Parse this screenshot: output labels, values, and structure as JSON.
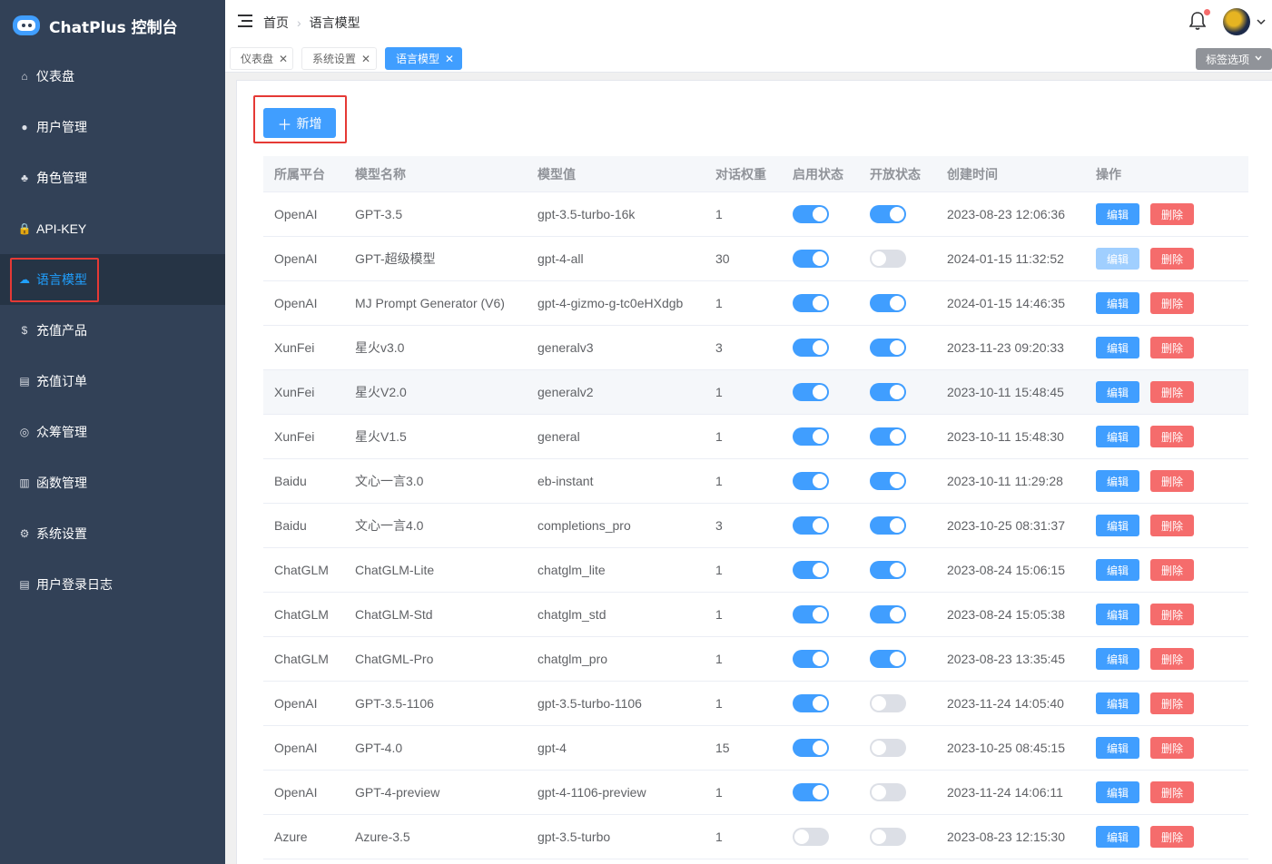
{
  "brand": {
    "title": "ChatPlus 控制台"
  },
  "sidebar": {
    "items": [
      {
        "label": "仪表盘",
        "icon": "home-icon"
      },
      {
        "label": "用户管理",
        "icon": "user-icon"
      },
      {
        "label": "角色管理",
        "icon": "role-icon"
      },
      {
        "label": "API-KEY",
        "icon": "lock-icon"
      },
      {
        "label": "语言模型",
        "icon": "model-icon",
        "active": true
      },
      {
        "label": "充值产品",
        "icon": "dollar-icon"
      },
      {
        "label": "充值订单",
        "icon": "order-icon"
      },
      {
        "label": "众筹管理",
        "icon": "crowdfund-icon"
      },
      {
        "label": "函数管理",
        "icon": "function-icon"
      },
      {
        "label": "系统设置",
        "icon": "gear-icon"
      },
      {
        "label": "用户登录日志",
        "icon": "log-icon"
      }
    ]
  },
  "header": {
    "breadcrumb": [
      "首页",
      "语言模型"
    ]
  },
  "tags": {
    "items": [
      "仪表盘",
      "系统设置",
      "语言模型"
    ],
    "active_index": 2,
    "options_label": "标签选项"
  },
  "toolbar": {
    "add_label": "新增"
  },
  "table": {
    "columns": [
      "所属平台",
      "模型名称",
      "模型值",
      "对话权重",
      "启用状态",
      "开放状态",
      "创建时间",
      "操作"
    ],
    "edit_label": "编辑",
    "delete_label": "删除",
    "rows": [
      {
        "platform": "OpenAI",
        "name": "GPT-3.5",
        "value": "gpt-3.5-turbo-16k",
        "weight": "1",
        "enabled": true,
        "open": true,
        "created": "2023-08-23 12:06:36"
      },
      {
        "platform": "OpenAI",
        "name": "GPT-超级模型",
        "value": "gpt-4-all",
        "weight": "30",
        "enabled": true,
        "open": false,
        "created": "2024-01-15 11:32:52",
        "edit_disabled": true
      },
      {
        "platform": "OpenAI",
        "name": "MJ Prompt Generator (V6)",
        "value": "gpt-4-gizmo-g-tc0eHXdgb",
        "weight": "1",
        "enabled": true,
        "open": true,
        "created": "2024-01-15 14:46:35"
      },
      {
        "platform": "XunFei",
        "name": "星火v3.0",
        "value": "generalv3",
        "weight": "3",
        "enabled": true,
        "open": true,
        "created": "2023-11-23 09:20:33"
      },
      {
        "platform": "XunFei",
        "name": "星火V2.0",
        "value": "generalv2",
        "weight": "1",
        "enabled": true,
        "open": true,
        "created": "2023-10-11 15:48:45",
        "hover": true
      },
      {
        "platform": "XunFei",
        "name": "星火V1.5",
        "value": "general",
        "weight": "1",
        "enabled": true,
        "open": true,
        "created": "2023-10-11 15:48:30"
      },
      {
        "platform": "Baidu",
        "name": "文心一言3.0",
        "value": "eb-instant",
        "weight": "1",
        "enabled": true,
        "open": true,
        "created": "2023-10-11 11:29:28"
      },
      {
        "platform": "Baidu",
        "name": "文心一言4.0",
        "value": "completions_pro",
        "weight": "3",
        "enabled": true,
        "open": true,
        "created": "2023-10-25 08:31:37"
      },
      {
        "platform": "ChatGLM",
        "name": "ChatGLM-Lite",
        "value": "chatglm_lite",
        "weight": "1",
        "enabled": true,
        "open": true,
        "created": "2023-08-24 15:06:15"
      },
      {
        "platform": "ChatGLM",
        "name": "ChatGLM-Std",
        "value": "chatglm_std",
        "weight": "1",
        "enabled": true,
        "open": true,
        "created": "2023-08-24 15:05:38"
      },
      {
        "platform": "ChatGLM",
        "name": "ChatGML-Pro",
        "value": "chatglm_pro",
        "weight": "1",
        "enabled": true,
        "open": true,
        "created": "2023-08-23 13:35:45"
      },
      {
        "platform": "OpenAI",
        "name": "GPT-3.5-1106",
        "value": "gpt-3.5-turbo-1106",
        "weight": "1",
        "enabled": true,
        "open": false,
        "created": "2023-11-24 14:05:40"
      },
      {
        "platform": "OpenAI",
        "name": "GPT-4.0",
        "value": "gpt-4",
        "weight": "15",
        "enabled": true,
        "open": false,
        "created": "2023-10-25 08:45:15"
      },
      {
        "platform": "OpenAI",
        "name": "GPT-4-preview",
        "value": "gpt-4-1106-preview",
        "weight": "1",
        "enabled": true,
        "open": false,
        "created": "2023-11-24 14:06:11"
      },
      {
        "platform": "Azure",
        "name": "Azure-3.5",
        "value": "gpt-3.5-turbo",
        "weight": "1",
        "enabled": false,
        "open": false,
        "created": "2023-08-23 12:15:30"
      }
    ]
  }
}
